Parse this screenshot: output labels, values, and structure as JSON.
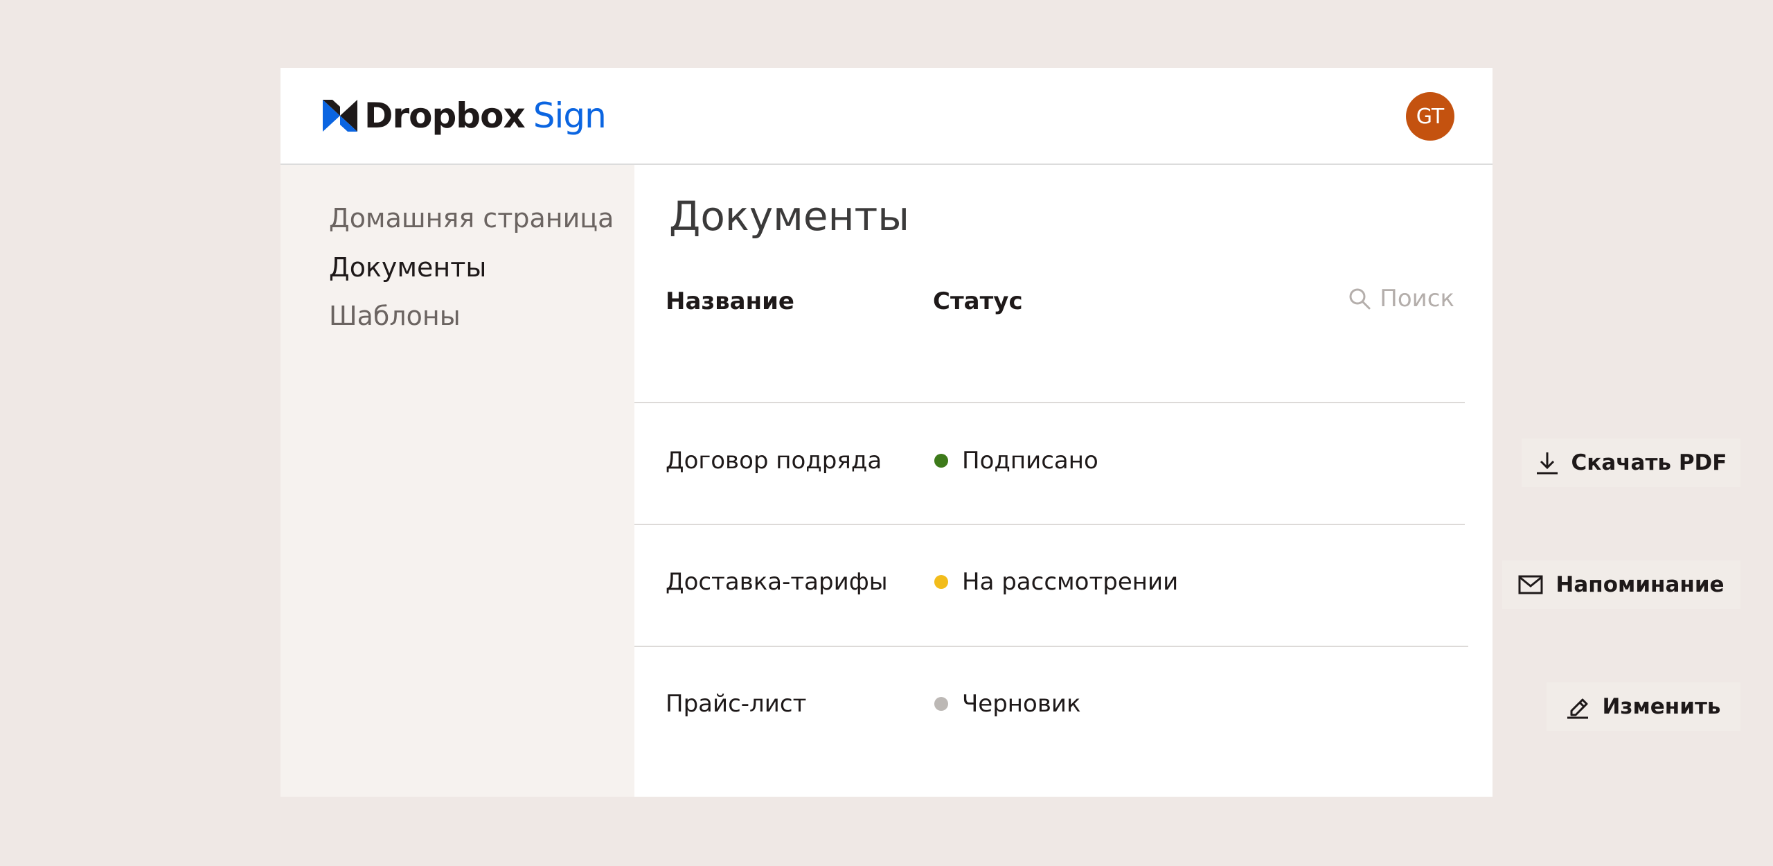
{
  "header": {
    "brand_main": "Dropbox",
    "brand_sub": "Sign",
    "avatar_initials": "GT",
    "avatar_color": "#c4520f",
    "brand_color": "#0b65e1"
  },
  "sidebar": {
    "items": [
      {
        "label": "Домашняя страница",
        "active": false
      },
      {
        "label": "Документы",
        "active": true
      },
      {
        "label": "Шаблоны",
        "active": false
      }
    ]
  },
  "main": {
    "title": "Документы",
    "columns": {
      "name": "Название",
      "status": "Статус"
    },
    "search": {
      "placeholder": "Поиск",
      "icon": "search-icon"
    },
    "rows": [
      {
        "name": "Договор подряда",
        "status": "Подписано",
        "status_color": "#3d7a1a",
        "action": "Скачать PDF",
        "action_icon": "download-icon"
      },
      {
        "name": "Доставка-тарифы",
        "status": "На рассмотрении",
        "status_color": "#f2bc1b",
        "action": "Напоминание",
        "action_icon": "mail-icon"
      },
      {
        "name": "Прайс-лист",
        "status": "Черновик",
        "status_color": "#bcb8b5",
        "action": "Изменить",
        "action_icon": "pencil-icon"
      }
    ]
  }
}
